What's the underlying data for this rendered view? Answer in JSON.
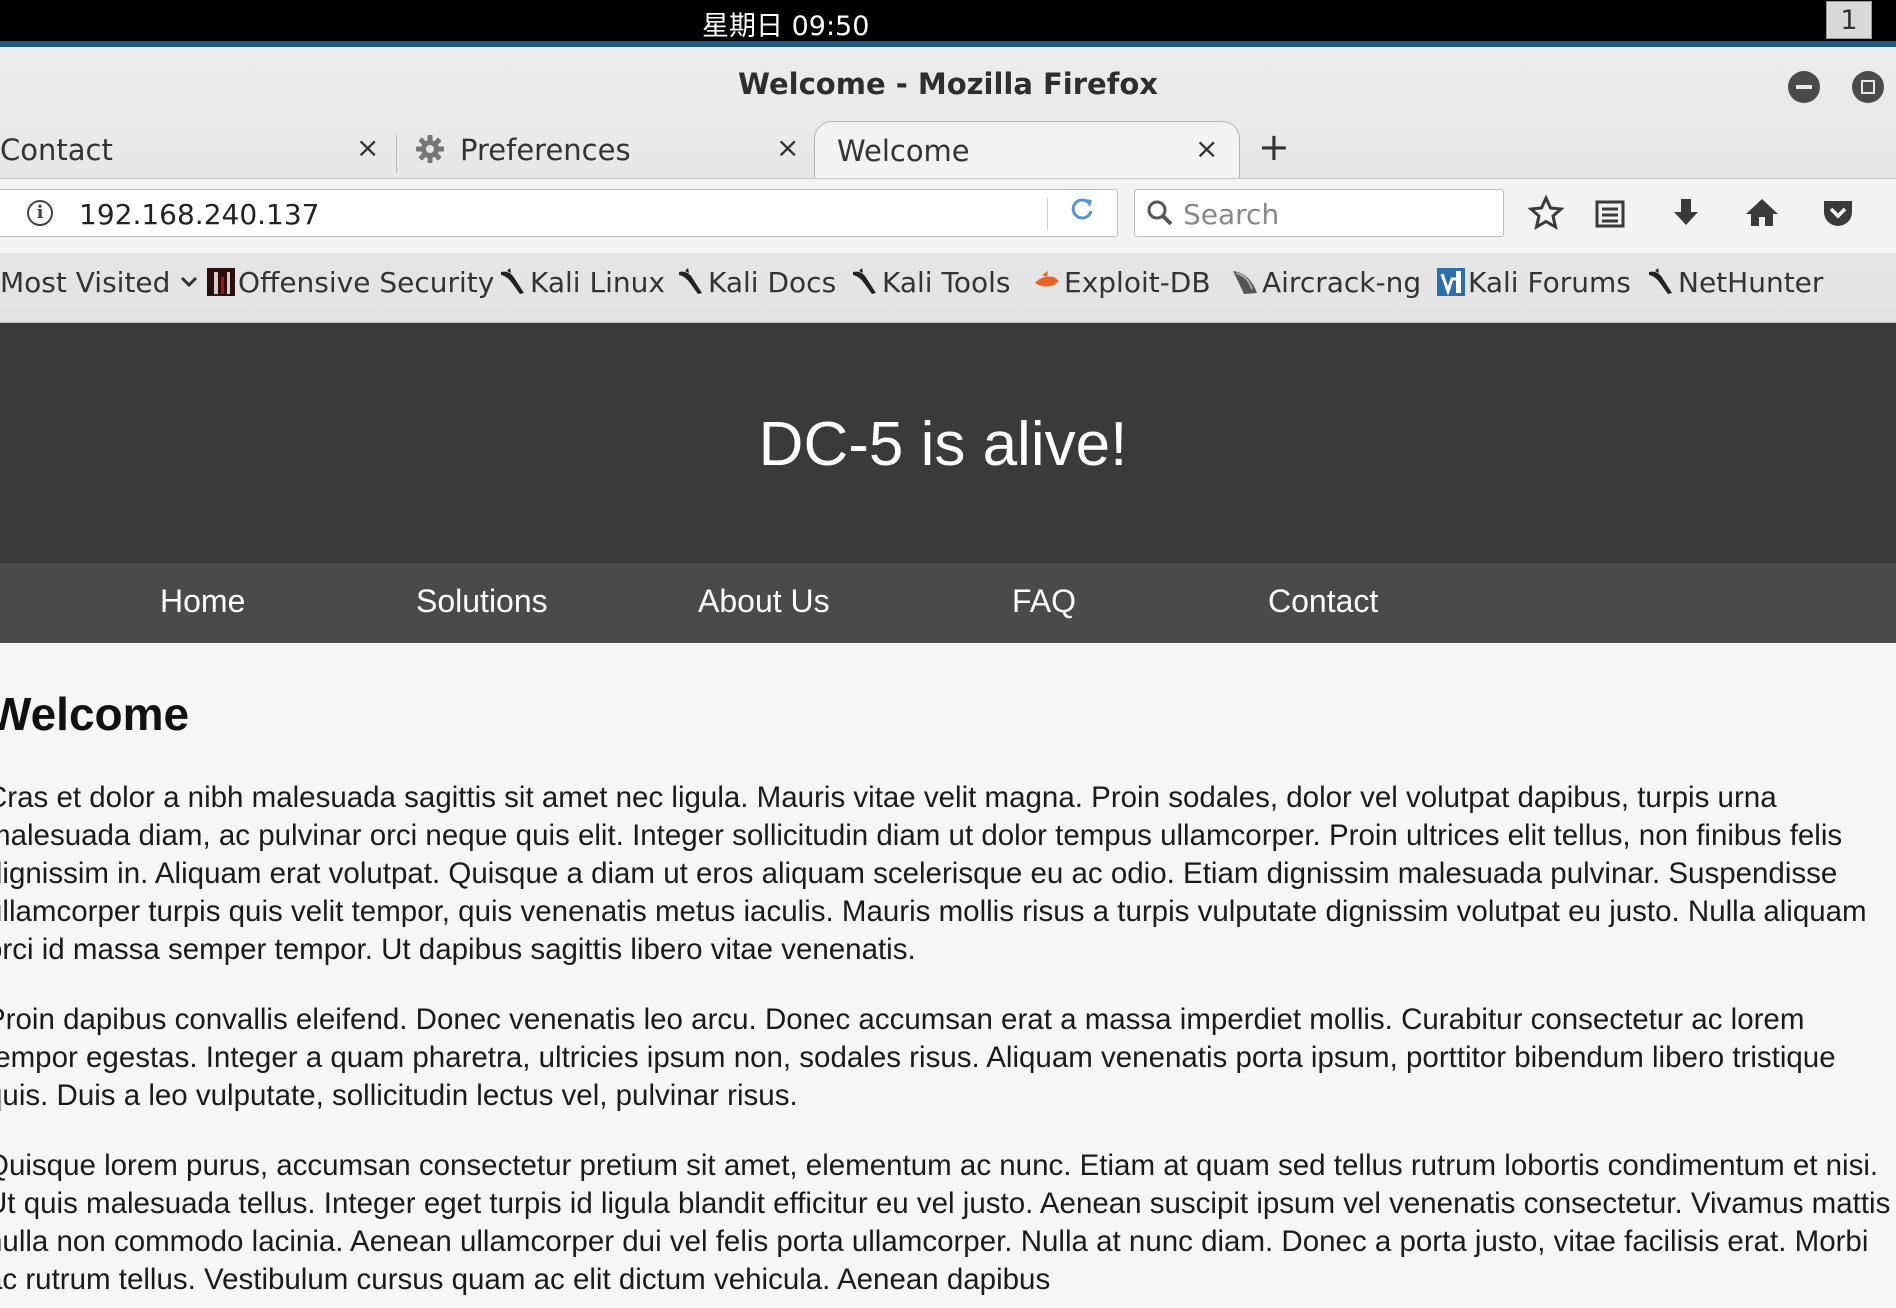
{
  "system_bar": {
    "clock": "星期日 09:50",
    "workspace": "1"
  },
  "window": {
    "title": "Welcome - Mozilla Firefox"
  },
  "tabs": [
    {
      "label": "Contact",
      "close": "×"
    },
    {
      "label": "Preferences",
      "close": "×"
    },
    {
      "label": "Welcome",
      "close": "×"
    }
  ],
  "new_tab": "+",
  "toolbar": {
    "url": "192.168.240.137",
    "search_placeholder": "Search"
  },
  "bookmarks": [
    {
      "label": "Most Visited",
      "icon": "chevron-down-icon"
    },
    {
      "label": "Offensive Security",
      "icon": "offsec-icon"
    },
    {
      "label": "Kali Linux",
      "icon": "kali-dragon-icon"
    },
    {
      "label": "Kali Docs",
      "icon": "kali-dragon-icon"
    },
    {
      "label": "Kali Tools",
      "icon": "kali-dragon-icon"
    },
    {
      "label": "Exploit-DB",
      "icon": "exploitdb-icon"
    },
    {
      "label": "Aircrack-ng",
      "icon": "aircrack-icon"
    },
    {
      "label": "Kali Forums",
      "icon": "kali-forums-icon"
    },
    {
      "label": "NetHunter",
      "icon": "kali-dragon-icon"
    }
  ],
  "page": {
    "site_title": "DC-5 is alive!",
    "nav": [
      "Home",
      "Solutions",
      "About Us",
      "FAQ",
      "Contact"
    ],
    "heading": "Welcome",
    "paragraphs": [
      "Cras et dolor a nibh malesuada sagittis sit amet nec ligula. Mauris vitae velit magna. Proin sodales, dolor vel volutpat dapibus, turpis urna malesuada diam, ac pulvinar orci neque quis elit. Integer sollicitudin diam ut dolor tempus ullamcorper. Proin ultrices elit tellus, non finibus felis dignissim in. Aliquam erat volutpat. Quisque a diam ut eros aliquam scelerisque eu ac odio. Etiam dignissim malesuada pulvinar. Suspendisse ullamcorper turpis quis velit tempor, quis venenatis metus iaculis. Mauris mollis risus a turpis vulputate dignissim volutpat eu justo. Nulla aliquam orci id massa semper tempor. Ut dapibus sagittis libero vitae venenatis.",
      "Proin dapibus convallis eleifend. Donec venenatis leo arcu. Donec accumsan erat a massa imperdiet mollis. Curabitur consectetur ac lorem tempor egestas. Integer a quam pharetra, ultricies ipsum non, sodales risus. Aliquam venenatis porta ipsum, porttitor bibendum libero tristique quis. Duis a leo vulputate, sollicitudin lectus vel, pulvinar risus.",
      "Quisque lorem purus, accumsan consectetur pretium sit amet, elementum ac nunc. Etiam at quam sed tellus rutrum lobortis condimentum et nisi. Ut quis malesuada tellus. Integer eget turpis id ligula blandit efficitur eu vel justo. Aenean suscipit ipsum vel venenatis consectetur. Vivamus mattis nulla non commodo lacinia. Aenean ullamcorper dui vel felis porta ullamcorper. Nulla at nunc diam. Donec a porta justo, vitae facilisis erat. Morbi ac rutrum tellus. Vestibulum cursus quam ac elit dictum vehicula. Aenean dapibus"
    ]
  },
  "colors": {
    "header_bg": "#3a3a3a",
    "nav_bg": "#4a4a4a",
    "page_bg": "#f6f6f6",
    "system_bar_accent": "#1d5a85"
  }
}
